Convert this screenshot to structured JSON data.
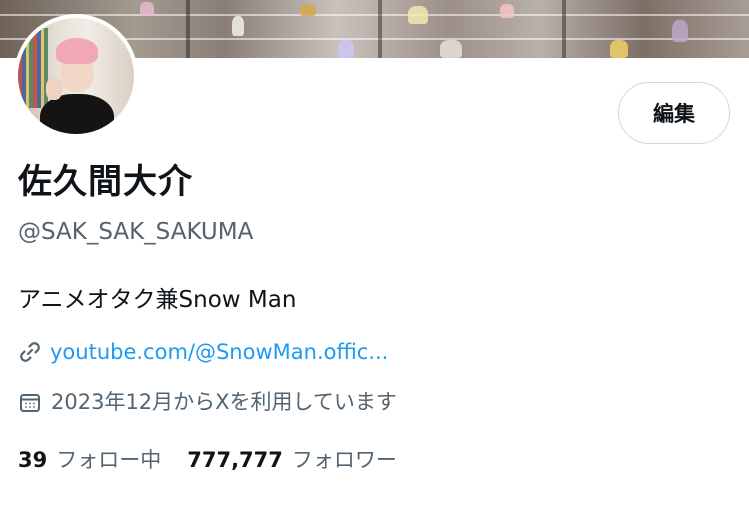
{
  "profile": {
    "name": "佐久間大介",
    "handle": "@SAK_SAK_SAKUMA",
    "bio": "アニメオタク兼Snow Man",
    "link": "youtube.com/@SnowMan.offic...",
    "joined": "2023年12月からXを利用しています",
    "following_count": "39",
    "following_label": "フォロー中",
    "followers_count": "777,777",
    "followers_label": "フォロワー"
  },
  "buttons": {
    "edit_label": "編集"
  },
  "icons": {
    "link": "link-icon",
    "calendar": "calendar-icon"
  },
  "colors": {
    "link": "#1d9bf0",
    "secondary_text": "#536471",
    "primary_text": "#0f1419",
    "button_border": "#cfd9de"
  }
}
